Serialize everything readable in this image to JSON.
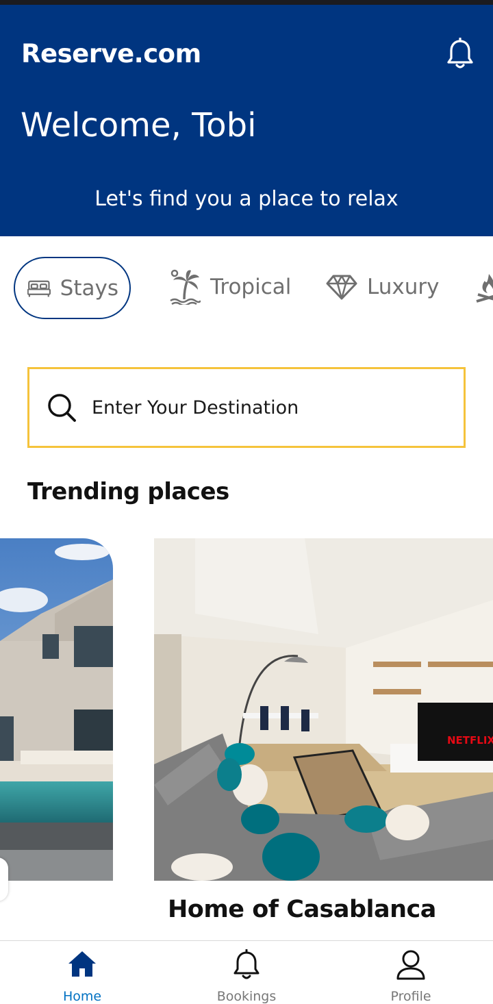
{
  "header": {
    "brand": "Reserve.com",
    "welcome": "Welcome, Tobi",
    "tagline": "Let's find you a place to relax",
    "notification_icon": "bell-icon"
  },
  "categories": [
    {
      "label": "Stays",
      "icon": "bed-icon",
      "active": true
    },
    {
      "label": "Tropical",
      "icon": "palm-tree-icon",
      "active": false
    },
    {
      "label": "Luxury",
      "icon": "diamond-icon",
      "active": false
    }
  ],
  "search": {
    "placeholder": "Enter Your Destination",
    "icon": "search-icon"
  },
  "trending": {
    "title": "Trending places",
    "cards": [
      {
        "title": ""
      },
      {
        "title": "Home of Casablanca"
      }
    ]
  },
  "nav": [
    {
      "label": "Home",
      "icon": "home-icon",
      "active": true
    },
    {
      "label": "Bookings",
      "icon": "bell-icon",
      "active": false
    },
    {
      "label": "Profile",
      "icon": "user-icon",
      "active": false
    }
  ],
  "colors": {
    "primary": "#003580",
    "accent": "#f5c33b",
    "nav_active": "#0071c2"
  }
}
